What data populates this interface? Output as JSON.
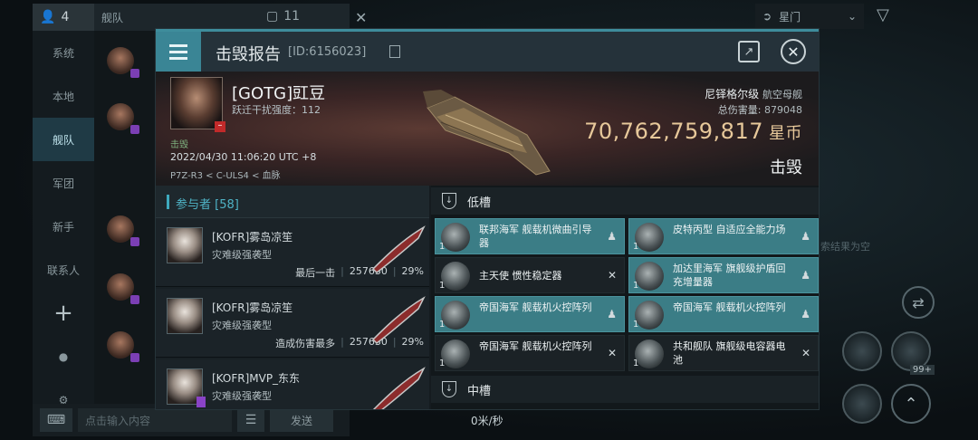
{
  "background": {
    "chat": {
      "member_count": "4",
      "channel_title": "舰队",
      "chat_count": "11",
      "sidebar": [
        "系统",
        "本地",
        "舰队",
        "军团",
        "新手",
        "联系人"
      ],
      "input_placeholder": "点击输入内容",
      "send_label": "发送"
    },
    "overview": {
      "filter_label": "星门",
      "empty_text": "索结果为空",
      "speed": "0米/秒",
      "module_qty": "99+"
    }
  },
  "modal": {
    "title": "击毁报告",
    "report_id": "[ID:6156023]",
    "victim": {
      "name": "[GOTG]豇豆",
      "jam_strength": "跃迁干扰强度：112",
      "kill_tag": "击毁",
      "datetime": "2022/04/30 11:06:20 UTC +8",
      "location": "P7Z-R3 < C-ULS4 < 血脉"
    },
    "ship": {
      "class_name": "尼铎格尔级",
      "class_type": "航空母舰",
      "total_damage_label": "总伤害量:",
      "total_damage": "879048",
      "isk_value": "70,762,759,817",
      "isk_unit": "星币",
      "status": "击毁"
    },
    "participants": {
      "header": "参与者 [58]",
      "items": [
        {
          "name": "[KOFR]雾岛凉笙",
          "ship": "灾难级强袭型",
          "role": "最后一击",
          "damage": "257630",
          "percent": "29%"
        },
        {
          "name": "[KOFR]雾岛凉笙",
          "ship": "灾难级强袭型",
          "role": "造成伤害最多",
          "damage": "257630",
          "percent": "29%"
        },
        {
          "name": "[KOFR]MVP_东东",
          "ship": "灾难级强袭型",
          "role": "",
          "damage": "",
          "percent": ""
        }
      ]
    },
    "fitting": {
      "low_slot_label": "低槽",
      "mid_slot_label": "中槽",
      "low_slots": [
        {
          "name": "联邦海军 舰载机微曲引导器",
          "qty": "1",
          "state": "dropped",
          "highlight": true
        },
        {
          "name": "皮特丙型 自适应全能力场",
          "qty": "1",
          "state": "dropped",
          "highlight": true
        },
        {
          "name": "主天使 惯性稳定器",
          "qty": "1",
          "state": "destroyed",
          "highlight": false
        },
        {
          "name": "加达里海军 旗舰级护盾回充增量器",
          "qty": "1",
          "state": "dropped",
          "highlight": true
        },
        {
          "name": "帝国海军 舰载机火控阵列",
          "qty": "1",
          "state": "dropped",
          "highlight": true
        },
        {
          "name": "帝国海军 舰载机火控阵列",
          "qty": "1",
          "state": "dropped",
          "highlight": true
        },
        {
          "name": "帝国海军 舰载机火控阵列",
          "qty": "1",
          "state": "destroyed",
          "highlight": false
        },
        {
          "name": "共和舰队 旗舰级电容器电池",
          "qty": "1",
          "state": "destroyed",
          "highlight": false
        }
      ]
    }
  }
}
